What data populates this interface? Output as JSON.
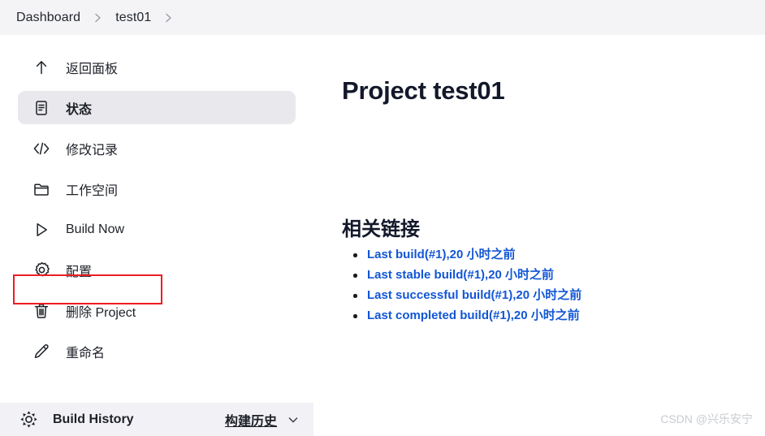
{
  "breadcrumb": {
    "items": [
      {
        "label": "Dashboard"
      },
      {
        "label": "test01"
      }
    ],
    "separator_icon": "chevron-right-icon"
  },
  "sidebar": {
    "items": [
      {
        "label": "返回面板",
        "icon": "arrow-up-icon",
        "active": false
      },
      {
        "label": "状态",
        "icon": "document-icon",
        "active": true
      },
      {
        "label": "修改记录",
        "icon": "code-brackets-icon",
        "active": false
      },
      {
        "label": "工作空间",
        "icon": "folder-icon",
        "active": false
      },
      {
        "label": "Build Now",
        "icon": "play-icon",
        "active": false
      },
      {
        "label": "配置",
        "icon": "gear-icon",
        "active": false,
        "highlighted": true
      },
      {
        "label": "删除 Project",
        "icon": "trash-icon",
        "active": false
      },
      {
        "label": "重命名",
        "icon": "pencil-icon",
        "active": false
      }
    ],
    "footer": {
      "icon": "sun-icon",
      "title": "Build History",
      "link_label": "构建历史",
      "caret_icon": "chevron-down-icon"
    },
    "highlight_color": "#ee1c24"
  },
  "main": {
    "page_title": "Project test01",
    "section_title": "相关链接",
    "links": [
      {
        "label": "Last build(#1),20 小时之前"
      },
      {
        "label": "Last stable build(#1),20 小时之前"
      },
      {
        "label": "Last successful build(#1),20 小时之前"
      },
      {
        "label": "Last completed build(#1),20 小时之前"
      }
    ],
    "link_color": "#1256d4"
  },
  "watermark": "CSDN @兴乐安宁"
}
